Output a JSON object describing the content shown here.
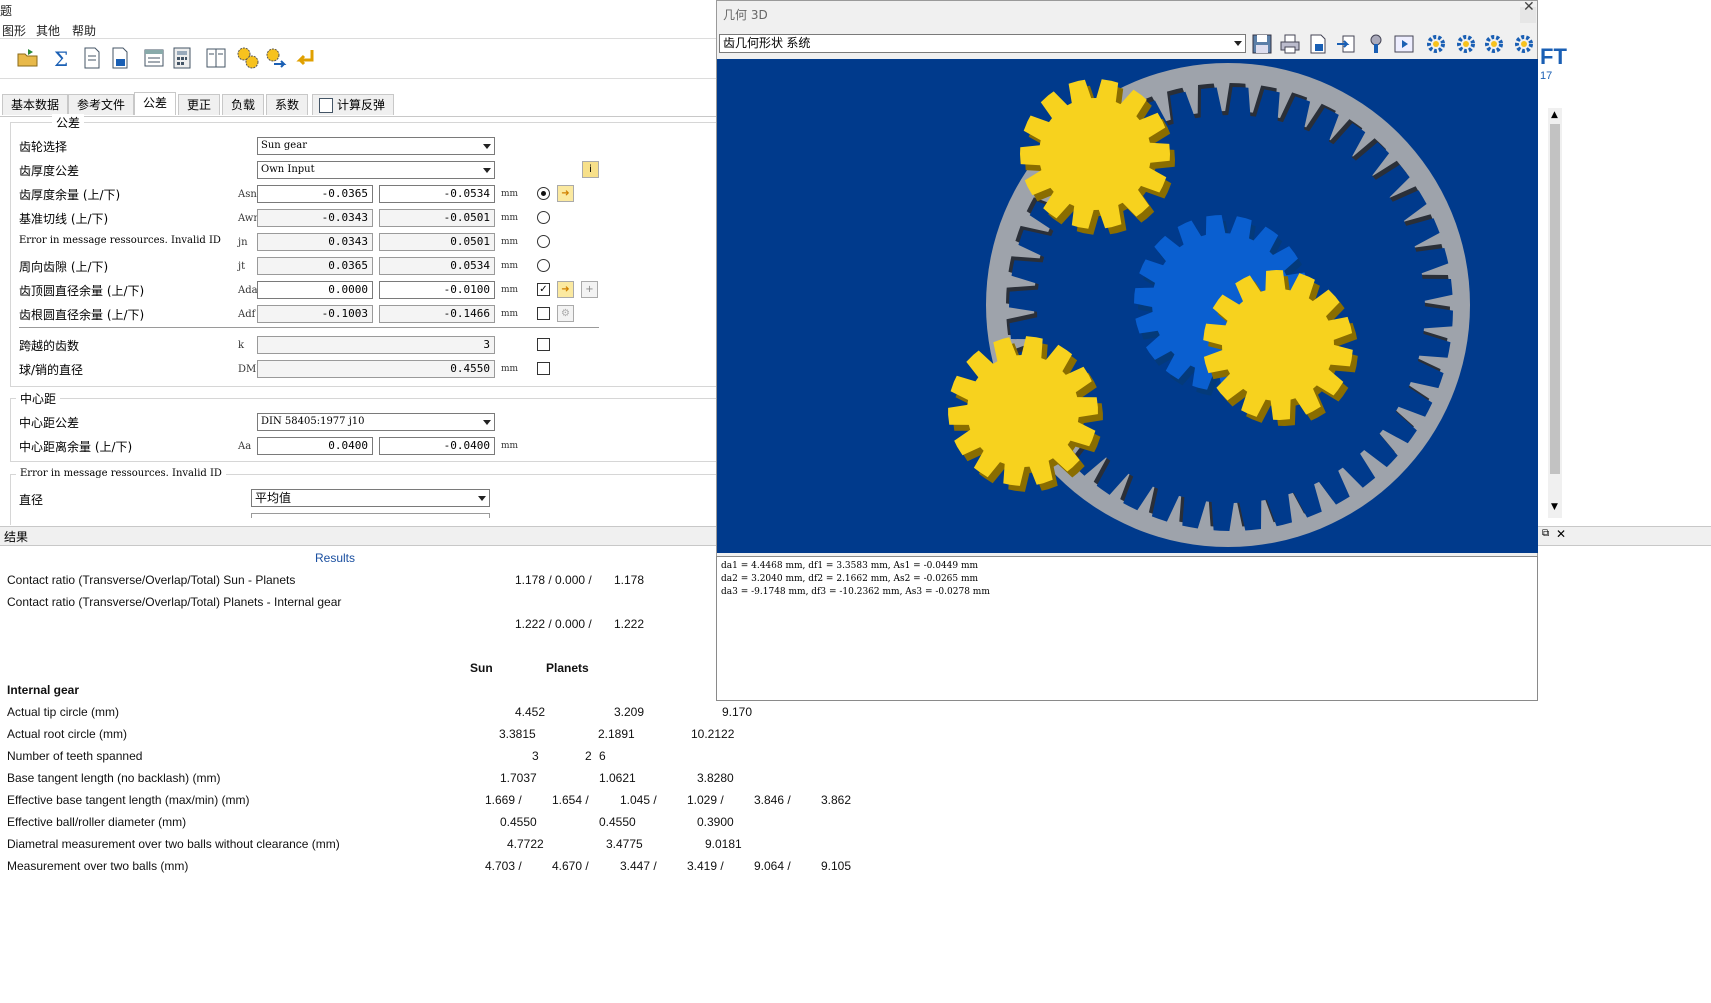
{
  "menu": {
    "title_fragment": "题",
    "items": [
      "图形",
      "其他",
      "帮助"
    ]
  },
  "toolbar": {
    "icons": [
      "open-folder-icon",
      "sum-icon",
      "document-icon",
      "report-icon",
      "print-preview-icon",
      "calculator-icon",
      "columns-icon",
      "gears-yellow-icon",
      "gears-arrow-icon",
      "arrow-return-icon"
    ]
  },
  "tabs": [
    "基本数据",
    "参考文件",
    "公差",
    "更正",
    "负载",
    "系数",
    "计算反弹"
  ],
  "tolerance": {
    "group_title": "公差",
    "gear_select_label": "齿轮选择",
    "gear_select_value": "Sun gear",
    "thickness_tol_label": "齿厚度公差",
    "thickness_tol_value": "Own Input",
    "rows": [
      {
        "label": "齿厚度余量 (上/下)",
        "sym": "Asn",
        "v1": "-0.0365",
        "v2": "-0.0534",
        "unit": "mm"
      },
      {
        "label": "基准切线 (上/下)",
        "sym": "Awn",
        "v1": "-0.0343",
        "v2": "-0.0501",
        "unit": "mm"
      },
      {
        "label": "Error in message ressources. Invalid ID",
        "sym": "jn",
        "v1": "0.0343",
        "v2": "0.0501",
        "unit": "mm"
      },
      {
        "label": "周向齿隙 (上/下)",
        "sym": "jt",
        "v1": "0.0365",
        "v2": "0.0534",
        "unit": "mm"
      },
      {
        "label": "齿顶圆直径余量 (上/下)",
        "sym": "Ada",
        "v1": "0.0000",
        "v2": "-0.0100",
        "unit": "mm"
      },
      {
        "label": "齿根圆直径余量 (上/下)",
        "sym": "Adf",
        "v1": "-0.1003",
        "v2": "-0.1466",
        "unit": "mm"
      }
    ],
    "teeth_spanned_label": "跨越的齿数",
    "teeth_spanned_sym": "k",
    "teeth_spanned_value": "3",
    "ball_dia_label": "球/销的直径",
    "ball_dia_sym": "DM",
    "ball_dia_value": "0.4550",
    "ball_dia_unit": "mm"
  },
  "center": {
    "group_title": "中心距",
    "tol_label": "中心距公差",
    "tol_value": "DIN 58405:1977 j10",
    "dev_label": "中心距离余量 (上/下)",
    "dev_sym": "Aa",
    "dev_v1": "0.0400",
    "dev_v2": "-0.0400",
    "dev_unit": "mm"
  },
  "error_group": {
    "title": "Error in message ressources. Invalid ID",
    "dia_label": "直径",
    "dia_value": "平均值"
  },
  "results_bar": {
    "title": "结果"
  },
  "results": {
    "heading": "Results",
    "cr1_label": "Contact ratio (Transverse/Overlap/Total) Sun - Planets",
    "cr1_values": "1.178 / 0.000 /",
    "cr1_total": "1.178",
    "cr2_label": "Contact ratio (Transverse/Overlap/Total) Planets - Internal gear",
    "cr2_values": "1.222 / 0.000 /",
    "cr2_total": "1.222",
    "col_sun": "Sun",
    "col_planets": "Planets",
    "internal_gear": "Internal gear",
    "rows": [
      {
        "label": "Actual tip circle (mm)",
        "vals": [
          "4.452",
          "3.209",
          "9.170"
        ]
      },
      {
        "label": "Actual root circle (mm)",
        "vals": [
          "3.3815",
          "2.1891",
          "10.2122"
        ]
      },
      {
        "label": "Number of teeth spanned",
        "vals": [
          "3",
          "2",
          "6"
        ]
      },
      {
        "label": "Base tangent length (no backlash) (mm)",
        "vals": [
          "1.7037",
          "1.0621",
          "3.8280"
        ]
      },
      {
        "label": "Effective base tangent length (max/min) (mm)",
        "vals": [
          "1.669 /",
          "1.654 /",
          "1.045 /",
          "1.029 /",
          "3.846 /",
          "3.862"
        ]
      },
      {
        "label": "Effective ball/roller diameter (mm)",
        "vals": [
          "0.4550",
          "0.4550",
          "0.3900"
        ]
      },
      {
        "label": "Diametral measurement over two balls without clearance (mm)",
        "vals": [
          "4.7722",
          "3.4775",
          "9.0181"
        ]
      },
      {
        "label": "Measurement over two balls (mm)",
        "vals": [
          "4.703 /",
          "4.670 /",
          "3.447 /",
          "3.419 /",
          "9.064 /",
          "9.105"
        ]
      }
    ]
  },
  "window3d": {
    "title": "几何 3D",
    "combo_value": "齿几何形状 系统",
    "output_lines": [
      "da1 = 4.4468 mm, df1 = 3.3583 mm, As1 = -0.0449 mm",
      "da2 = 3.2040 mm, df2 = 2.1662 mm, As2 = -0.0265 mm",
      "da3 = -9.1748 mm, df3 = -10.2362 mm, As3 = -0.0278 mm"
    ],
    "colors": {
      "background": "#003a8c",
      "ring": "#9ea3ab",
      "sun": "#0a5fd0",
      "planet": "#f7d21e"
    }
  },
  "brand": {
    "text": "FT",
    "sub": "17"
  }
}
